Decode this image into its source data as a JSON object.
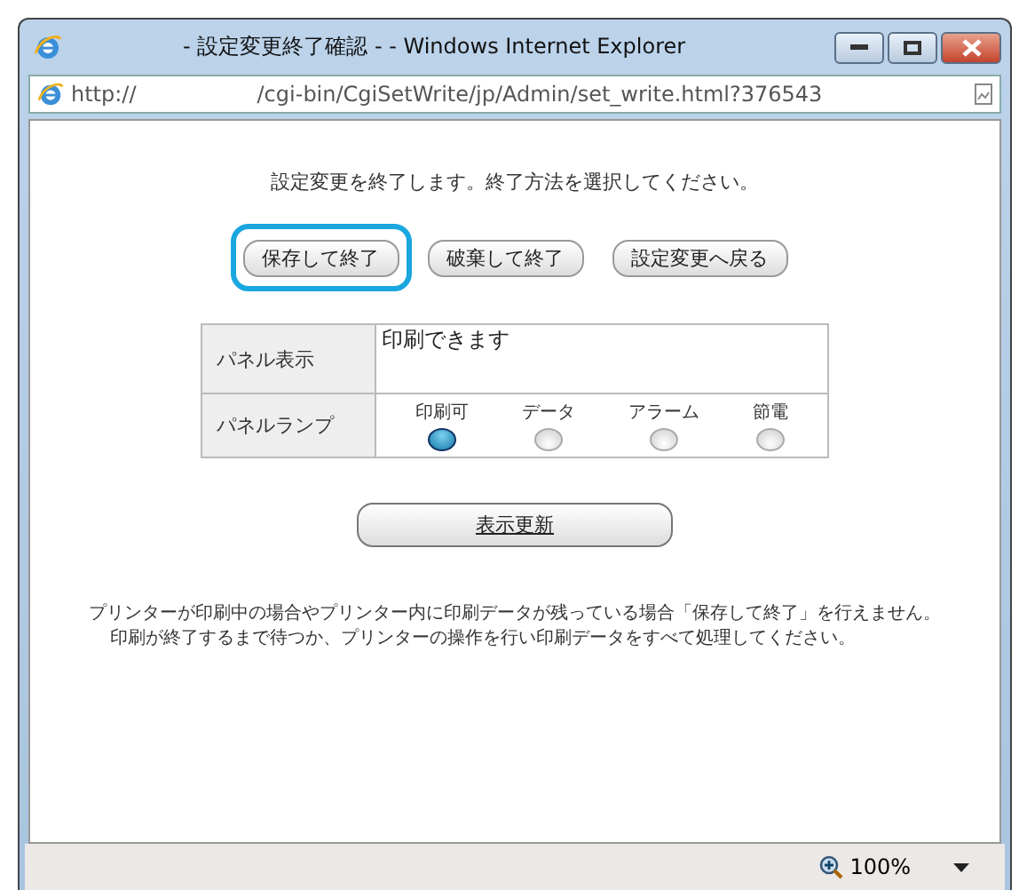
{
  "window": {
    "title": "- 設定変更終了確認 - - Windows Internet Explorer"
  },
  "address_bar": {
    "scheme": "http://",
    "path": "/cgi-bin/CgiSetWrite/jp/Admin/set_write.html?376543"
  },
  "message": "設定変更を終了します。終了方法を選択してください。",
  "buttons": [
    {
      "label": "保存して終了",
      "highlighted": true
    },
    {
      "label": "破棄して終了",
      "highlighted": false
    },
    {
      "label": "設定変更へ戻る",
      "highlighted": false
    }
  ],
  "panel": {
    "display_label": "パネル表示",
    "display_value": "印刷できます",
    "lamp_label": "パネルランプ",
    "lamps": [
      {
        "label": "印刷可",
        "on": true
      },
      {
        "label": "データ",
        "on": false
      },
      {
        "label": "アラーム",
        "on": false
      },
      {
        "label": "節電",
        "on": false
      }
    ]
  },
  "refresh_button": "表示更新",
  "notes": [
    "プリンターが印刷中の場合やプリンター内に印刷データが残っている場合「保存して終了」を行えません。",
    "印刷が終了するまで待つか、プリンターの操作を行い印刷データをすべて処理してください。"
  ],
  "status_bar": {
    "zoom": "100%"
  }
}
